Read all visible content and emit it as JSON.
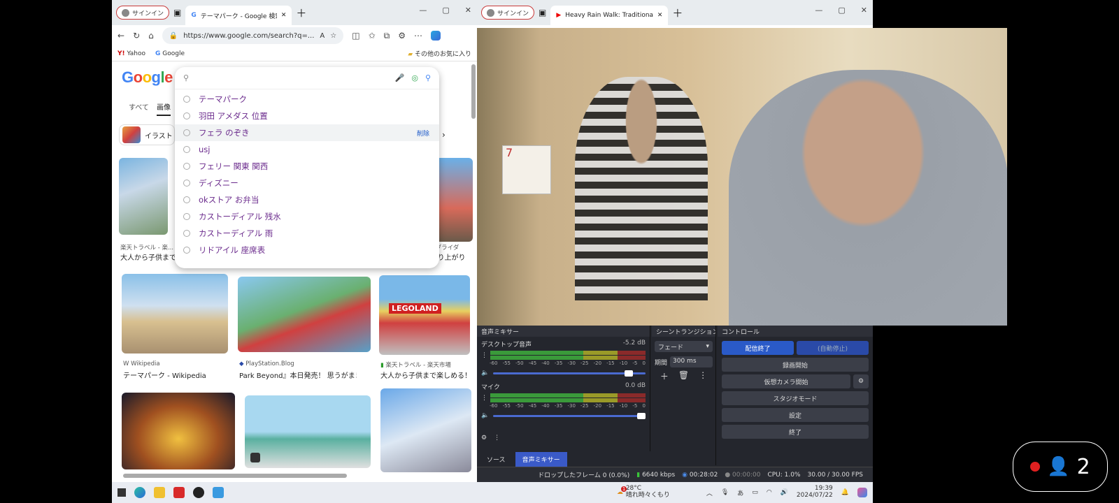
{
  "left_browser": {
    "signin": "サインイン",
    "tab_title": "テーマパーク - Google 検索",
    "url": "https://www.google.com/search?q=...",
    "favorites": [
      "Yahoo",
      "Google"
    ],
    "other_favorites": "その他のお気に入り",
    "google_logo": "Google",
    "search_tabs": [
      "すべて",
      "画像"
    ],
    "filter_chip": "イラスト",
    "suggestions": [
      "テーマパーク",
      "羽田 アメダス 位置",
      "フェラ のぞき",
      "usj",
      "フェリー 関東 関西",
      "ディズニー",
      "okストア お弁当",
      "カストーディアル 残水",
      "カストーディアル 雨",
      "リドアイル 座席表"
    ],
    "suggestion_delete": "削除",
    "results": [
      {
        "source": "楽天トラベル - 楽...",
        "title": "大人から子供まで..."
      },
      {
        "source": "...・ブライダ",
        "title": "...盛り上がり"
      },
      {
        "source": "Wikipedia",
        "title": "テーマパーク - Wikipedia"
      },
      {
        "source": "PlayStation.Blog",
        "title": "Park Beyond』本日発売！ 思うがままに..."
      },
      {
        "source": "楽天トラベル - 楽天市場",
        "title": "大人から子供まで楽しめる！"
      }
    ],
    "legoland_text": "LEGOLAND"
  },
  "right_browser": {
    "signin": "サインイン",
    "tab_title": "Heavy Rain Walk: Traditional Japa..."
  },
  "calendar_text": "7",
  "obs": {
    "mixer_title": "音声ミキサー",
    "desktop_audio": "デスクトップ音声",
    "desktop_db": "-5.2 dB",
    "mic": "マイク",
    "mic_db": "0.0 dB",
    "meter_ticks": [
      "-60",
      "-55",
      "-50",
      "-45",
      "-40",
      "-35",
      "-30",
      "-25",
      "-20",
      "-15",
      "-10",
      "-5",
      "0"
    ],
    "transition_title": "シーントランジション",
    "transition_value": "フェード",
    "duration_label": "期間",
    "duration_value": "300 ms",
    "controls_title": "コントロール",
    "controls": [
      "配信終了",
      "(自動停止)",
      "録画開始",
      "仮想カメラ開始",
      "スタジオモード",
      "設定",
      "終了"
    ],
    "bottom_tabs": [
      "ソース",
      "音声ミキサー"
    ],
    "status": {
      "dropped": "ドロップしたフレーム 0 (0.0%)",
      "bitrate": "6640 kbps",
      "stream_time": "00:28:02",
      "rec_time": "00:00:00",
      "cpu": "CPU: 1.0%",
      "fps": "30.00 / 30.00 FPS"
    }
  },
  "taskbar": {
    "weather_temp": "28°C",
    "weather_desc": "晴れ時々くもり",
    "weather_badge": "1",
    "ime": "あ",
    "time": "19:39",
    "date": "2024/07/22"
  },
  "viewers": {
    "count": "2"
  }
}
